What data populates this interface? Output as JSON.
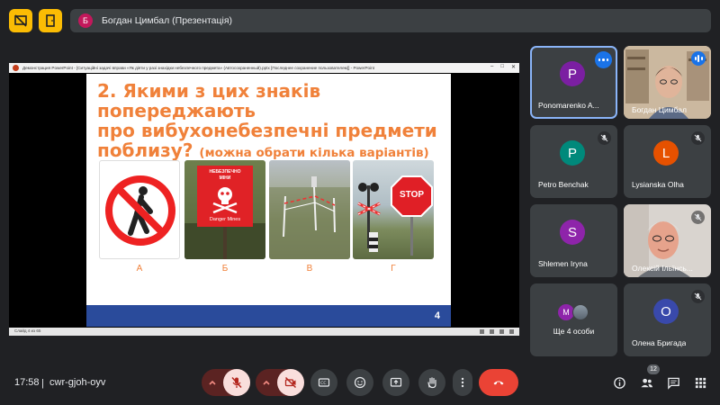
{
  "presenter": {
    "avatar_letter": "Б",
    "label": "Богдан Цимбал (Презентація)"
  },
  "ppt": {
    "window_title": "Демонстрация PowerPoint - [Ситуаційні задачі вправи «Як діяти у разі знахідки небезпечного предмета» (Автосохраненный).pptx [Последнее сохранение пользователем]] - PowerPoint",
    "status_text": "Слайд 4 из 65"
  },
  "slide": {
    "question_line1": "2. Якими з цих знаків попереджають",
    "question_line2": "про вибухонебезпечні предмети",
    "question_line3": "поблизу?",
    "question_hint": "(можна обрати кілька варіантів)",
    "mine_sign_top": "НЕБЕЗПЕЧНО",
    "mine_sign_mid": "МІНИ",
    "mine_sign_bottom": "Danger Mines",
    "stop_text": "STOP",
    "labels": [
      "А",
      "Б",
      "В",
      "Г"
    ],
    "number": "4"
  },
  "participants": [
    {
      "name": "Ponomarenko A...",
      "letter": "P",
      "color": "#7b1fa2"
    },
    {
      "name": "Богдан Цимбал",
      "video": true
    },
    {
      "name": "Petro Benchak",
      "letter": "P",
      "color": "#00897b"
    },
    {
      "name": "Lysianska Olha",
      "letter": "L",
      "color": "#e65100"
    },
    {
      "name": "Shlemen Iryna",
      "letter": "S",
      "color": "#8e24aa"
    },
    {
      "name": "Олексій Ільїнсь...",
      "video": true
    },
    {
      "name": "Ще 4 особи",
      "letter": "M",
      "color": "#8e24aa"
    },
    {
      "name": "Олена Бригада",
      "letter": "О",
      "color": "#3949ab"
    }
  ],
  "bottom": {
    "time": "17:58",
    "separator": "|",
    "meeting_code": "cwr-gjoh-oyv",
    "people_count": "12"
  },
  "colors": {
    "accent_yellow": "#fbbc04",
    "slide_orange": "#f0813a",
    "slide_blue": "#2a4b9b",
    "end_call_red": "#ea4335"
  }
}
